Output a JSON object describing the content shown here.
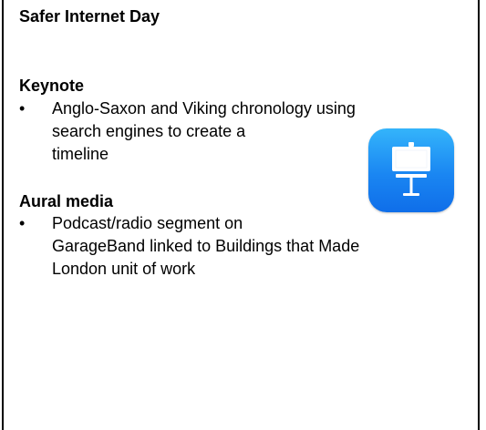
{
  "title": "Safer Internet Day",
  "sections": [
    {
      "heading": "Keynote",
      "bullet": "•",
      "text": "Anglo-Saxon and Viking chronology using\nsearch engines to create a\ntimeline"
    },
    {
      "heading": "Aural media",
      "bullet": "•",
      "text": "Podcast/radio segment on\nGarageBand linked to Buildings that Made\nLondon unit of work"
    }
  ],
  "icons": {
    "app": "keynote-app-icon"
  },
  "colors": {
    "icon_gradient_top": "#34b4fb",
    "icon_gradient_bottom": "#0f6ee9",
    "text": "#000000",
    "border": "#000000"
  }
}
